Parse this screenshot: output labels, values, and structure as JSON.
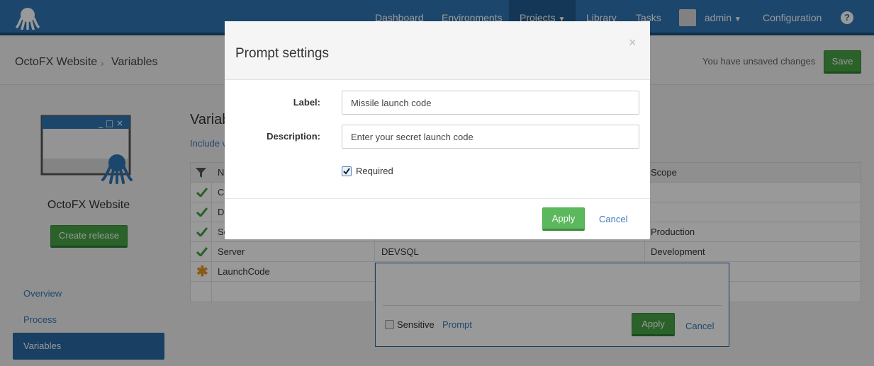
{
  "nav": {
    "items": [
      {
        "label": "Dashboard"
      },
      {
        "label": "Environments"
      },
      {
        "label": "Projects"
      },
      {
        "label": "Library"
      },
      {
        "label": "Tasks"
      },
      {
        "label": "admin"
      },
      {
        "label": "Configuration"
      }
    ],
    "help_label": "?"
  },
  "header": {
    "project": "OctoFX Website",
    "separator": "›",
    "page": "Variables",
    "unsaved_text": "You have unsaved changes",
    "save_label": "Save"
  },
  "sidebar": {
    "project_name": "OctoFX Website",
    "create_release_label": "Create release",
    "links": [
      {
        "label": "Overview"
      },
      {
        "label": "Process"
      },
      {
        "label": "Variables"
      }
    ]
  },
  "variables": {
    "title": "Variab",
    "include_link": "Include v",
    "columns": {
      "name": "N",
      "scope": "Scope"
    },
    "rows": [
      {
        "name": "Co",
        "value": "",
        "scope": ""
      },
      {
        "name": "D",
        "value": "",
        "scope": ""
      },
      {
        "name": "Se",
        "value": "",
        "scope": "Production"
      },
      {
        "name": "Server",
        "value": "DEVSQL",
        "scope": "Development"
      },
      {
        "name": "LaunchCode",
        "value": "",
        "scope": ""
      }
    ]
  },
  "editor": {
    "sensitive_label": "Sensitive",
    "prompt_label": "Prompt",
    "apply_label": "Apply",
    "cancel_label": "Cancel"
  },
  "modal": {
    "title": "Prompt settings",
    "close_label": "×",
    "label_field": {
      "label": "Label:",
      "value": "Missile launch code"
    },
    "description_field": {
      "label": "Description:",
      "value": "Enter your secret launch code"
    },
    "required_label": "Required",
    "required_checked": true,
    "apply_label": "Apply",
    "cancel_label": "Cancel"
  }
}
